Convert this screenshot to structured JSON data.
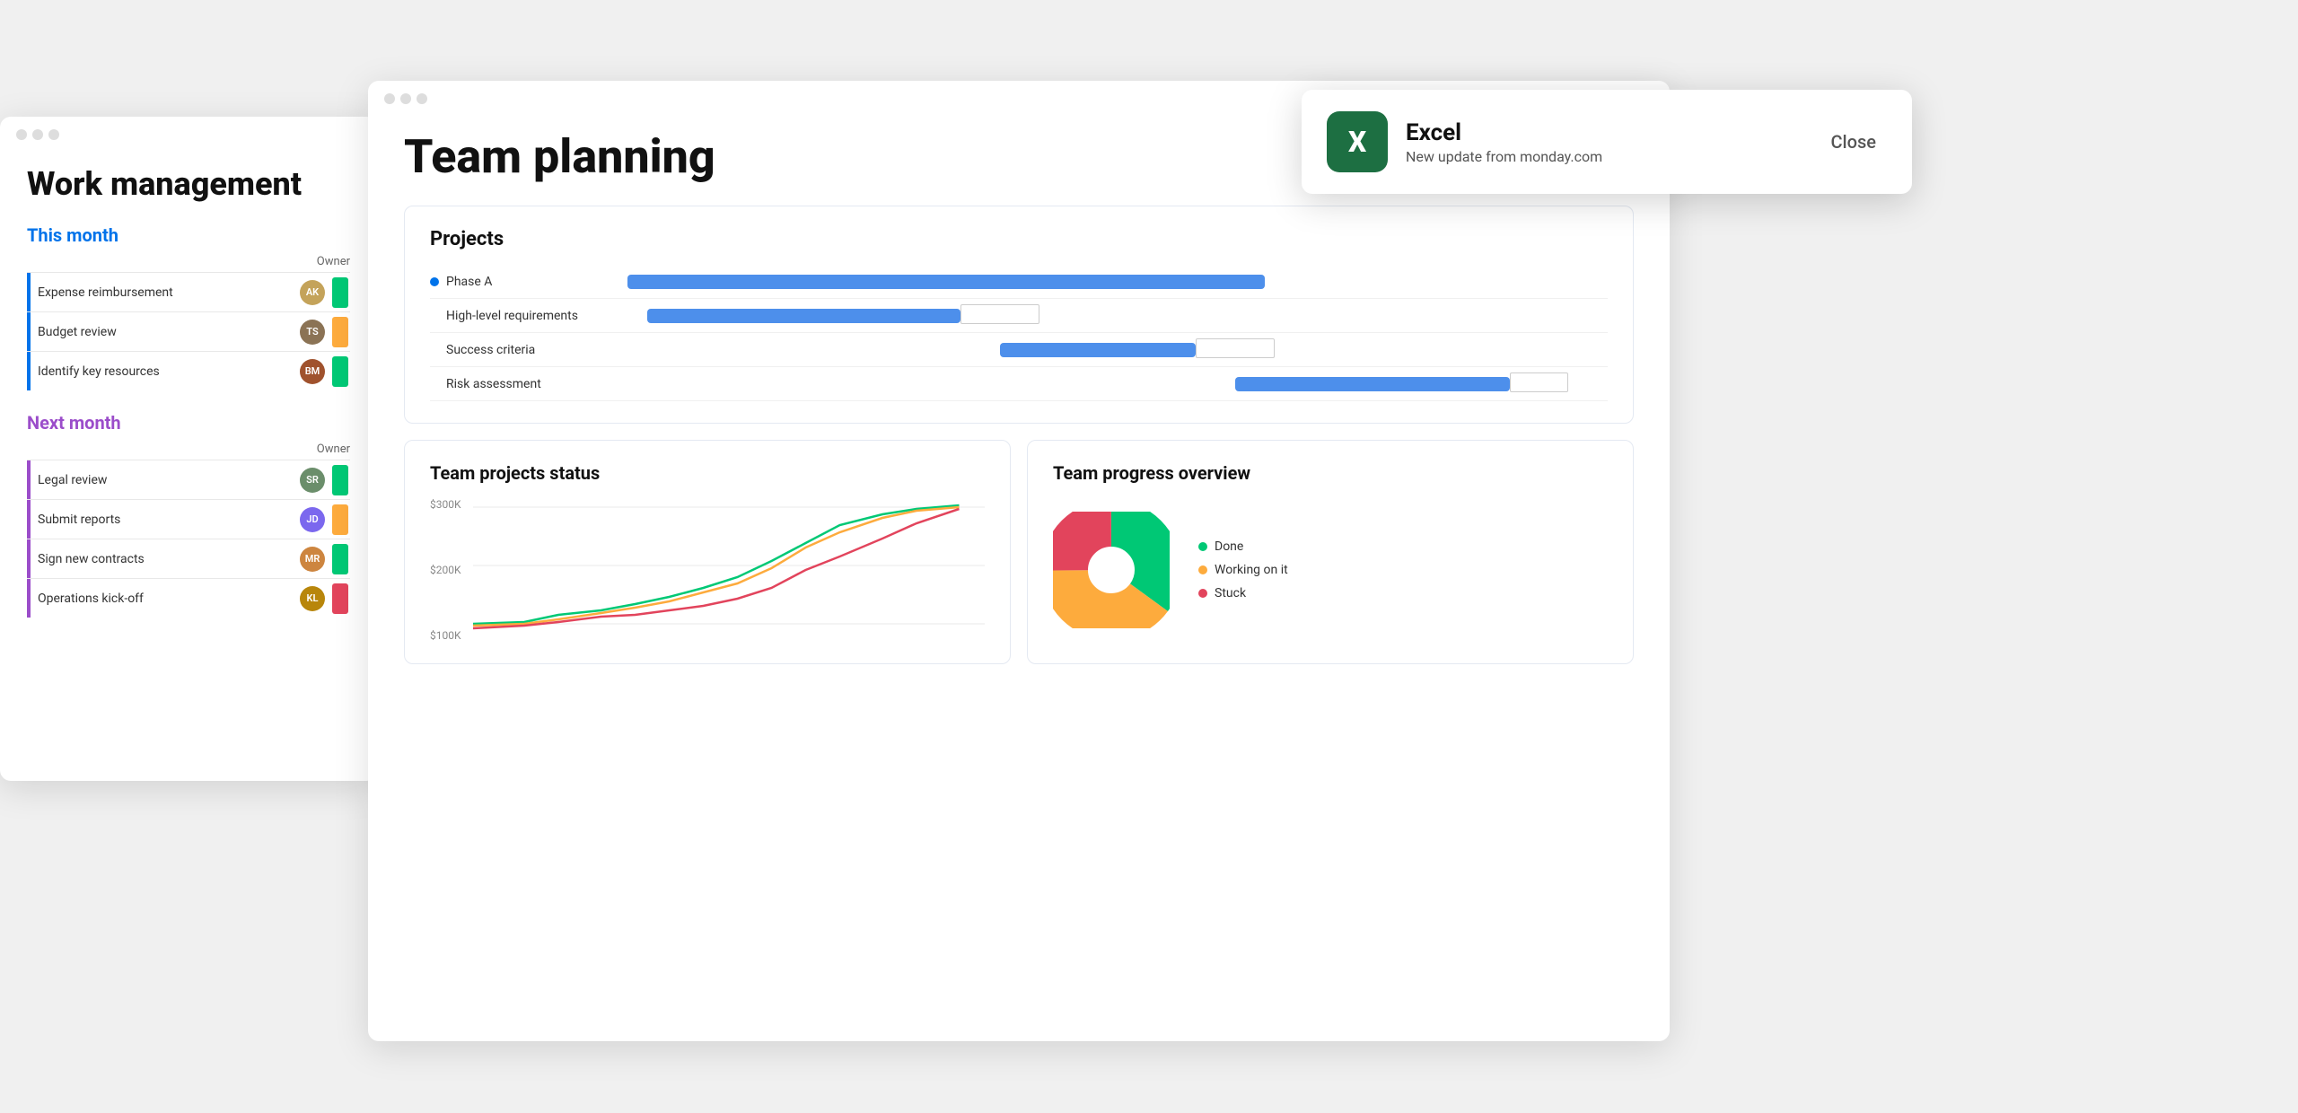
{
  "leftWindow": {
    "title": "Work management",
    "thisMonth": {
      "label": "This month",
      "ownerHeader": "Owner",
      "tasks": [
        {
          "name": "Expense reimbursement",
          "avatarInitials": "AK",
          "avatarClass": "av1",
          "statusColor": "green"
        },
        {
          "name": "Budget review",
          "avatarInitials": "TS",
          "avatarClass": "av2",
          "statusColor": "orange"
        },
        {
          "name": "Identify key resources",
          "avatarInitials": "BM",
          "avatarClass": "av3",
          "statusColor": "green"
        }
      ]
    },
    "nextMonth": {
      "label": "Next month",
      "ownerHeader": "Owner",
      "tasks": [
        {
          "name": "Legal review",
          "avatarInitials": "SR",
          "avatarClass": "av4",
          "statusColor": "green"
        },
        {
          "name": "Submit reports",
          "avatarInitials": "JD",
          "avatarClass": "av5",
          "statusColor": "orange"
        },
        {
          "name": "Sign new contracts",
          "avatarInitials": "MR",
          "avatarClass": "av6",
          "statusColor": "green"
        },
        {
          "name": "Operations kick-off",
          "avatarInitials": "KL",
          "avatarClass": "av7",
          "statusColor": "red"
        }
      ]
    }
  },
  "mainWindow": {
    "title": "Team planning",
    "projects": {
      "heading": "Projects",
      "gantt": {
        "phaseLabel": "Phase A",
        "tasks": [
          {
            "name": "High-level requirements"
          },
          {
            "name": "Success criteria"
          },
          {
            "name": "Risk assessment"
          }
        ]
      }
    },
    "teamStatus": {
      "heading": "Team projects status",
      "yLabels": [
        "$300K",
        "$200K",
        "$100K"
      ]
    },
    "teamProgress": {
      "heading": "Team progress overview",
      "legend": [
        {
          "label": "Done",
          "color": "#00C875"
        },
        {
          "label": "Working on it",
          "color": "#FDAB3D"
        },
        {
          "label": "Stuck",
          "color": "#E2445C"
        }
      ]
    }
  },
  "notification": {
    "appName": "Excel",
    "message": "New update from monday.com",
    "closeLabel": "Close",
    "iconLetter": "X"
  }
}
